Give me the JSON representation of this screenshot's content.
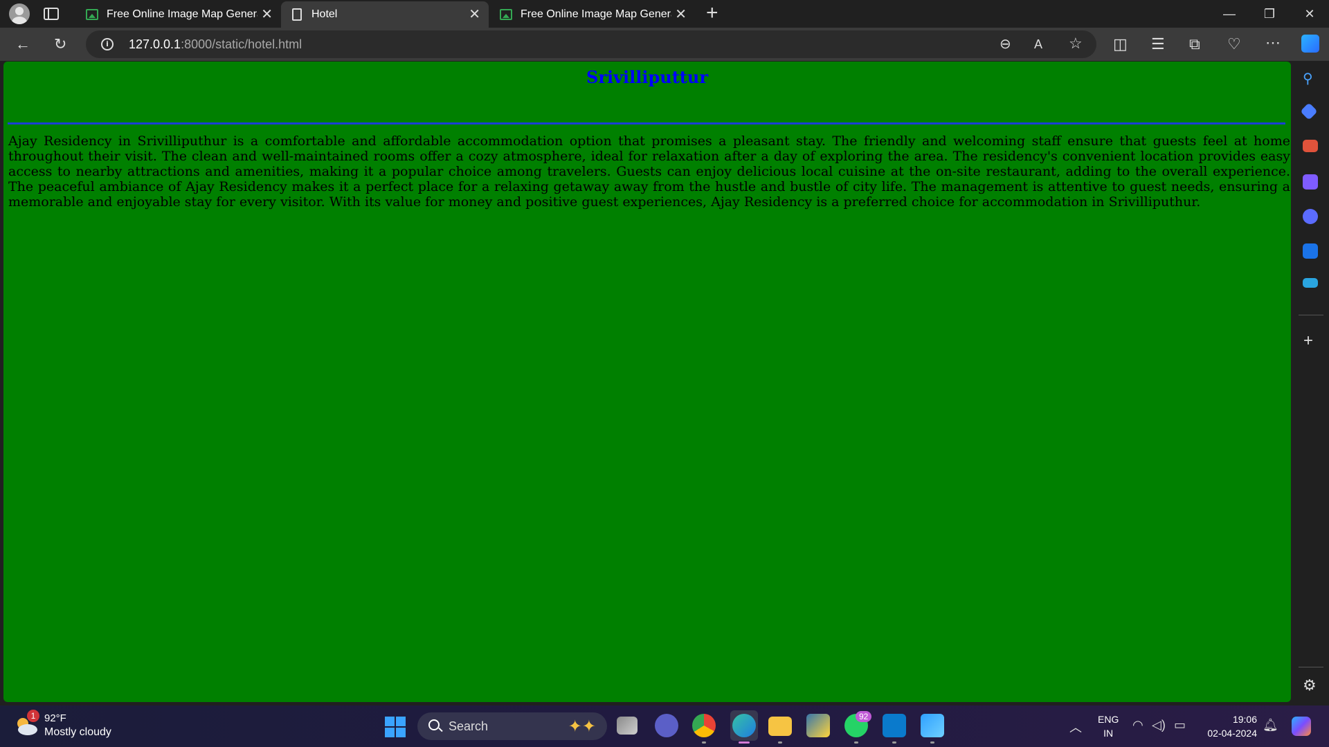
{
  "browser": {
    "tabs": [
      {
        "label": "Free Online Image Map Generator",
        "active": false,
        "favicon": "image-map-icon"
      },
      {
        "label": "Hotel",
        "active": true,
        "favicon": "page-icon"
      },
      {
        "label": "Free Online Image Map Generator",
        "active": false,
        "favicon": "image-map-icon"
      }
    ],
    "url_host": "127.0.0.1",
    "url_path": ":8000/static/hotel.html"
  },
  "page": {
    "heading": "Srivilliputtur",
    "paragraph": "Ajay Residency in Srivilliputhur is a comfortable and affordable accommodation option that promises a pleasant stay. The friendly and welcoming staff ensure that guests feel at home throughout their visit. The clean and well-maintained rooms offer a cozy atmosphere, ideal for relaxation after a day of exploring the area. The residency's convenient location provides easy access to nearby attractions and amenities, making it a popular choice among travelers. Guests can enjoy delicious local cuisine at the on-site restaurant, adding to the overall experience. The peaceful ambiance of Ajay Residency makes it a perfect place for a relaxing getaway away from the hustle and bustle of city life. The management is attentive to guest needs, ensuring a memorable and enjoyable stay for every visitor. With its value for money and positive guest experiences, Ajay Residency is a preferred choice for accommodation in Srivilliputhur.",
    "background_color": "#008000",
    "heading_color": "#0000ff"
  },
  "taskbar": {
    "weather_badge": "1",
    "weather_temp": "92°F",
    "weather_condition": "Mostly cloudy",
    "search_label": "Search",
    "whatsapp_badge": "92",
    "lang_top": "ENG",
    "lang_bottom": "IN",
    "time": "19:06",
    "date": "02-04-2024"
  }
}
